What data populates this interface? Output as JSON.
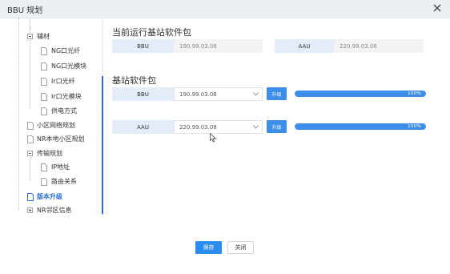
{
  "window": {
    "title": "BBU 规划"
  },
  "tree": {
    "items": [
      {
        "label": "辅材",
        "level": 1,
        "toggle": "minus"
      },
      {
        "label": "NG口光纤",
        "level": 2
      },
      {
        "label": "NG口光模块",
        "level": 2
      },
      {
        "label": "Ir口光纤",
        "level": 2
      },
      {
        "label": "Ir口光模块",
        "level": 2
      },
      {
        "label": "供电方式",
        "level": 2
      },
      {
        "label": "小区网络规划",
        "level": 1
      },
      {
        "label": "NR本地小区规划",
        "level": 1
      },
      {
        "label": "传输规划",
        "level": 1,
        "toggle": "minus"
      },
      {
        "label": "IP地址",
        "level": 2
      },
      {
        "label": "路由关系",
        "level": 2
      },
      {
        "label": "版本升级",
        "level": 1,
        "active": true
      },
      {
        "label": "NR邻区信息",
        "level": 1,
        "toggle": "plus"
      }
    ]
  },
  "current": {
    "title": "当前运行基站软件包",
    "bbu_label": "BBU",
    "bbu_value": "190.99.03.08",
    "aau_label": "AAU",
    "aau_value": "220.99.03.08"
  },
  "package": {
    "title": "基站软件包",
    "rows": [
      {
        "label": "BBU",
        "version": "190.99.03.08",
        "button": "升级",
        "progress": 1.0,
        "progress_text": "100%"
      },
      {
        "label": "AAU",
        "version": "220.99.03.08",
        "button": "升级",
        "progress": 1.0,
        "progress_text": "100%"
      }
    ]
  },
  "footer": {
    "save": "保存",
    "close": "关闭"
  },
  "colors": {
    "accent": "#3d8ee8",
    "active_tree": "#2b6fd6",
    "label_bg": "#e3ecf8"
  }
}
